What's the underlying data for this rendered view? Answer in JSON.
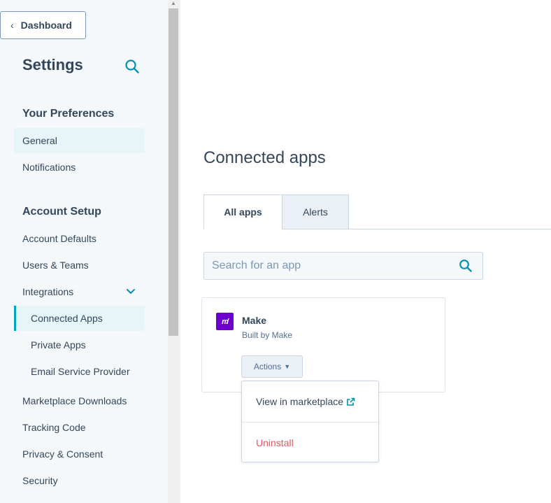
{
  "sidebar": {
    "back_label": "Dashboard",
    "title": "Settings",
    "sections": {
      "preferences": "Your Preferences",
      "account_setup": "Account Setup"
    },
    "items": {
      "general": "General",
      "notifications": "Notifications",
      "account_defaults": "Account Defaults",
      "users_teams": "Users & Teams",
      "integrations": "Integrations",
      "connected_apps": "Connected Apps",
      "private_apps": "Private Apps",
      "email_service_provider": "Email Service Provider",
      "marketplace_downloads": "Marketplace Downloads",
      "tracking_code": "Tracking Code",
      "privacy_consent": "Privacy & Consent",
      "security": "Security"
    }
  },
  "main": {
    "title": "Connected apps",
    "tabs": {
      "all_apps": "All apps",
      "alerts": "Alerts"
    },
    "search": {
      "placeholder": "Search for an app",
      "value": ""
    },
    "app": {
      "logo_text": "m",
      "name": "Make",
      "built_by": "Built by Make",
      "actions_label": "Actions"
    },
    "dropdown": {
      "view_marketplace": "View in marketplace",
      "uninstall": "Uninstall"
    }
  },
  "colors": {
    "accent": "#00a4bd",
    "text": "#33475b",
    "danger": "#f2545b",
    "make_brand": "#6d00cc",
    "link_icon": "#0091ae"
  },
  "icons": [
    "chevron-left-icon",
    "search-icon",
    "chevron-down-icon",
    "caret-down-icon",
    "external-link-icon"
  ]
}
